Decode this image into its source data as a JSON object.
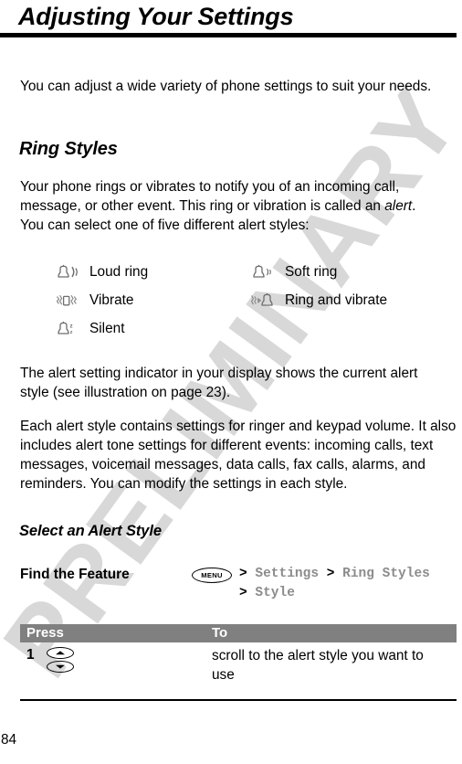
{
  "document": {
    "title": "Adjusting Your Settings",
    "page_number": "84",
    "watermark": "PRELIMINARY"
  },
  "intro": {
    "paragraph": "You can adjust a wide variety of phone settings to suit your needs."
  },
  "ring_styles": {
    "heading": "Ring Styles",
    "paragraph_prefix": "Your phone rings or vibrates to notify you of an incoming call, message, or other event. This ring or vibration is called an ",
    "paragraph_italic": "alert",
    "paragraph_suffix": ". You can select one of five different alert styles:",
    "alert_styles": [
      {
        "icon": "bell-loud-ring-icon",
        "label": "Loud ring"
      },
      {
        "icon": "bell-soft-ring-icon",
        "label": "Soft ring"
      },
      {
        "icon": "vibrate-icon",
        "label": "Vibrate"
      },
      {
        "icon": "ring-and-vibrate-icon",
        "label": "Ring and vibrate"
      },
      {
        "icon": "bell-silent-icon",
        "label": "Silent"
      }
    ],
    "paragraph_indicator": "The alert setting indicator in your display shows the current alert style (see illustration on page 23).",
    "paragraph_settings": "Each alert style contains settings for ringer and keypad volume. It also includes alert tone settings for different events: incoming calls, text messages, voicemail messages, data calls, fax calls, alarms, and reminders. You can modify the settings in each style."
  },
  "select_alert_style": {
    "heading": "Select an Alert Style",
    "find_the_feature": {
      "label": "Find the Feature",
      "menu_key_label": "MENU",
      "path_line1_items": [
        "Settings",
        "Ring Styles"
      ],
      "path_line2_items": [
        "Style"
      ],
      "separator": ">"
    },
    "steps_table": {
      "columns": [
        "Press",
        "To"
      ],
      "rows": [
        {
          "number": "1",
          "key_icons": [
            "scroll-up-key-icon",
            "scroll-down-key-icon"
          ],
          "action": "scroll to the alert style you want to use"
        }
      ]
    }
  },
  "colors": {
    "rule": "#000000",
    "table_header_bg": "#808080",
    "table_header_text": "#ffffff",
    "menu_path_text": "#8c8c8c",
    "watermark": "#d8d8d8",
    "icon_gray": "#6e6e6e"
  }
}
